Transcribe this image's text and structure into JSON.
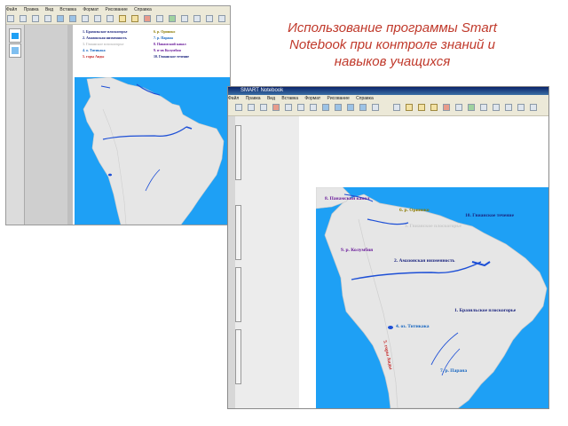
{
  "slide": {
    "title_lines": [
      "Использование программы Smart",
      "Notebook при контроле знаний и",
      "навыков учащихся"
    ]
  },
  "window_back": {
    "legend_left": [
      "1. Бразильское плоскогорье",
      "2. Амазонская низменность",
      "3. Гвианское плоскогорье",
      "4. о. Титикака",
      "5. горы Анды"
    ],
    "legend_right": [
      "6. р. Ориноко",
      "7. р. Парана",
      "8. Панамский канал",
      "9. п-ов Колумбия",
      "10. Гвианское течение"
    ]
  },
  "window_front": {
    "title": "SMART Notebook",
    "menu": [
      "Файл",
      "Правка",
      "Вид",
      "Вставка",
      "Формат",
      "Рисование",
      "Справка"
    ],
    "map_labels": {
      "l8": "8. Панамский канал",
      "l6": "6. р. Ориноко",
      "l10": "10. Гвианское течение",
      "l3": "3. Гвианское плоскогорье",
      "l9": "9. р. Колумбия",
      "l2": "2. Амазонская низменность",
      "l1": "1. Бразильское плоскогорье",
      "l4": "4. оз. Титикака",
      "l5": "5. горы Анды",
      "l7": "7. р. Парана"
    }
  },
  "colors": {
    "title_red": "#c0392b",
    "sea": "#1ea0f5",
    "land": "#e6e6e6",
    "river": "#1d4fd6",
    "legend_purple": "#6a1b9a",
    "legend_navy": "#1a237e",
    "legend_red": "#c62828",
    "legend_olive": "#8a7a00",
    "legend_teal": "#1565c0"
  }
}
